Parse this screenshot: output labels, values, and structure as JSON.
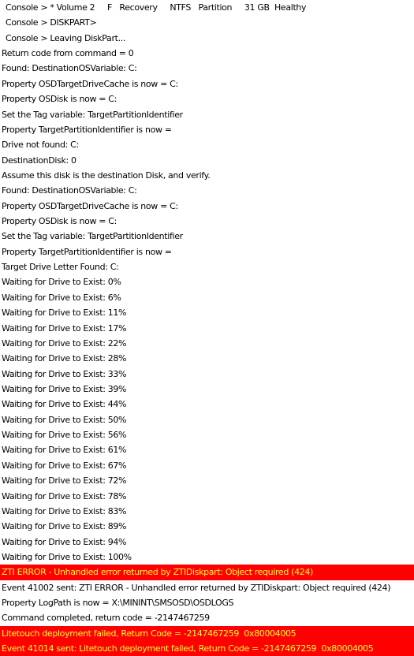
{
  "colors": {
    "error_background": "#ff0000",
    "error_text": "#ffff33",
    "normal_text": "#000000",
    "background": "#ffffff"
  },
  "log": [
    {
      "type": "console",
      "text": "Console > * Volume 2     F   Recovery     NTFS   Partition     31 GB  Healthy"
    },
    {
      "type": "console",
      "text": "Console > DISKPART>"
    },
    {
      "type": "console",
      "text": "Console > Leaving DiskPart..."
    },
    {
      "type": "normal",
      "text": "Return code from command = 0"
    },
    {
      "type": "normal",
      "text": "Found: DestinationOSVariable: C:"
    },
    {
      "type": "normal",
      "text": "Property OSDTargetDriveCache is now = C:"
    },
    {
      "type": "normal",
      "text": "Property OSDisk is now = C:"
    },
    {
      "type": "normal",
      "text": "Set the Tag variable: TargetPartitionIdentifier"
    },
    {
      "type": "normal",
      "text": "Property TargetPartitionIdentifier is now ="
    },
    {
      "type": "normal",
      "text": "Drive not found: C:"
    },
    {
      "type": "normal",
      "text": "DestinationDisk: 0"
    },
    {
      "type": "normal",
      "text": "Assume this disk is the destination Disk, and verify."
    },
    {
      "type": "normal",
      "text": "Found: DestinationOSVariable: C:"
    },
    {
      "type": "normal",
      "text": "Property OSDTargetDriveCache is now = C:"
    },
    {
      "type": "normal",
      "text": "Property OSDisk is now = C:"
    },
    {
      "type": "normal",
      "text": "Set the Tag variable: TargetPartitionIdentifier"
    },
    {
      "type": "normal",
      "text": "Property TargetPartitionIdentifier is now ="
    },
    {
      "type": "normal",
      "text": "Target Drive Letter Found: C:"
    },
    {
      "type": "normal",
      "text": "Waiting for Drive to Exist: 0%"
    },
    {
      "type": "normal",
      "text": "Waiting for Drive to Exist: 6%"
    },
    {
      "type": "normal",
      "text": "Waiting for Drive to Exist: 11%"
    },
    {
      "type": "normal",
      "text": "Waiting for Drive to Exist: 17%"
    },
    {
      "type": "normal",
      "text": "Waiting for Drive to Exist: 22%"
    },
    {
      "type": "normal",
      "text": "Waiting for Drive to Exist: 28%"
    },
    {
      "type": "normal",
      "text": "Waiting for Drive to Exist: 33%"
    },
    {
      "type": "normal",
      "text": "Waiting for Drive to Exist: 39%"
    },
    {
      "type": "normal",
      "text": "Waiting for Drive to Exist: 44%"
    },
    {
      "type": "normal",
      "text": "Waiting for Drive to Exist: 50%"
    },
    {
      "type": "normal",
      "text": "Waiting for Drive to Exist: 56%"
    },
    {
      "type": "normal",
      "text": "Waiting for Drive to Exist: 61%"
    },
    {
      "type": "normal",
      "text": "Waiting for Drive to Exist: 67%"
    },
    {
      "type": "normal",
      "text": "Waiting for Drive to Exist: 72%"
    },
    {
      "type": "normal",
      "text": "Waiting for Drive to Exist: 78%"
    },
    {
      "type": "normal",
      "text": "Waiting for Drive to Exist: 83%"
    },
    {
      "type": "normal",
      "text": "Waiting for Drive to Exist: 89%"
    },
    {
      "type": "normal",
      "text": "Waiting for Drive to Exist: 94%"
    },
    {
      "type": "normal",
      "text": "Waiting for Drive to Exist: 100%"
    },
    {
      "type": "error",
      "text": "ZTI ERROR - Unhandled error returned by ZTIDiskpart: Object required (424)"
    },
    {
      "type": "normal",
      "text": "Event 41002 sent: ZTI ERROR - Unhandled error returned by ZTIDiskpart: Object required (424)"
    },
    {
      "type": "normal",
      "text": "Property LogPath is now = X:\\MININT\\SMSOSD\\OSDLOGS"
    },
    {
      "type": "normal",
      "text": "Command completed, return code = -2147467259"
    },
    {
      "type": "error",
      "text": "Litetouch deployment failed, Return Code = -2147467259  0x80004005"
    },
    {
      "type": "error",
      "text": "Event 41014 sent: Litetouch deployment failed, Return Code = -2147467259  0x80004005"
    }
  ]
}
